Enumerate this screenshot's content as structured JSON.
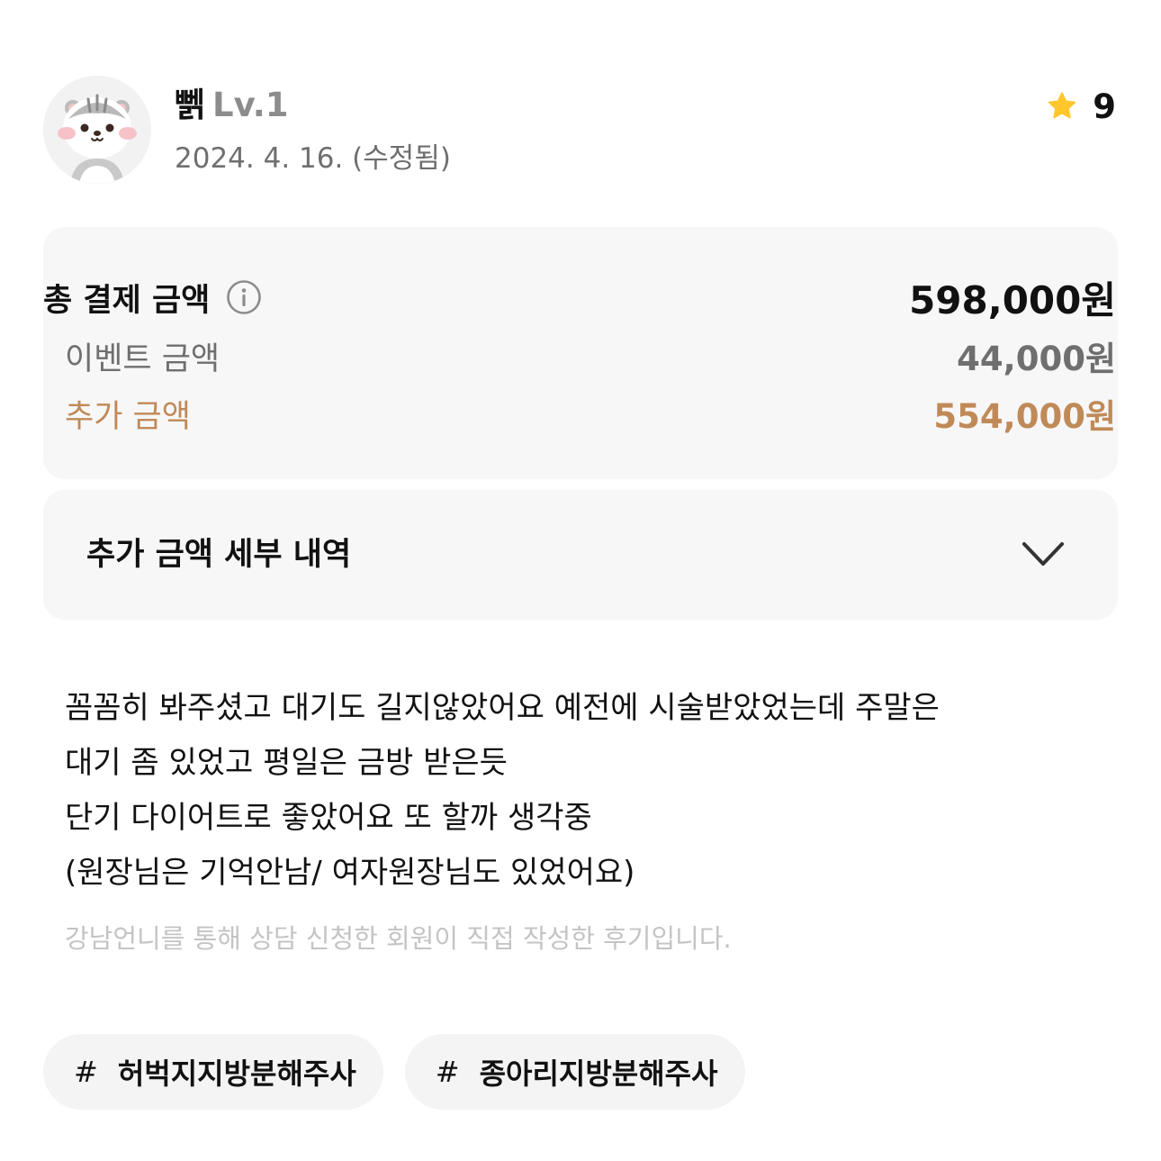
{
  "header": {
    "user_name": "뻵",
    "user_level": "Lv.1",
    "date": "2024. 4. 16. (수정됨)",
    "star_count": "9",
    "avatar_icon": "hamster-avatar-icon",
    "star_icon": "star-icon"
  },
  "price": {
    "total_label": "총 결제 금액",
    "total_value": "598,000원",
    "event_label": "이벤트 금액",
    "event_value": "44,000원",
    "extra_label": "추가 금액",
    "extra_value": "554,000원",
    "info_icon": "info-icon"
  },
  "detail": {
    "title": "추가 금액 세부 내역",
    "toggle_icon": "chevron-down-icon"
  },
  "review": {
    "lines": [
      "꼼꼼히 봐주셨고 대기도 길지않았어요 예전에 시술받았었는데 주말은",
      "대기 좀 있었고 평일은 금방 받은듯",
      "단기 다이어트로 좋았어요 또 할까 생각중",
      "(원장님은 기억안남/ 여자원장님도 있었어요)"
    ],
    "note": "강남언니를 통해 상담 신청한 회원이 직접 작성한 후기입니다."
  },
  "tags": [
    {
      "hash": "#",
      "label": "허벅지지방분해주사"
    },
    {
      "hash": "#",
      "label": "종아리지방분해주사"
    }
  ],
  "colors": {
    "accent_brown": "#c08a58",
    "star_yellow": "#ffc72c",
    "muted_gray": "#6f6f6f",
    "box_bg": "#f7f7f7"
  }
}
